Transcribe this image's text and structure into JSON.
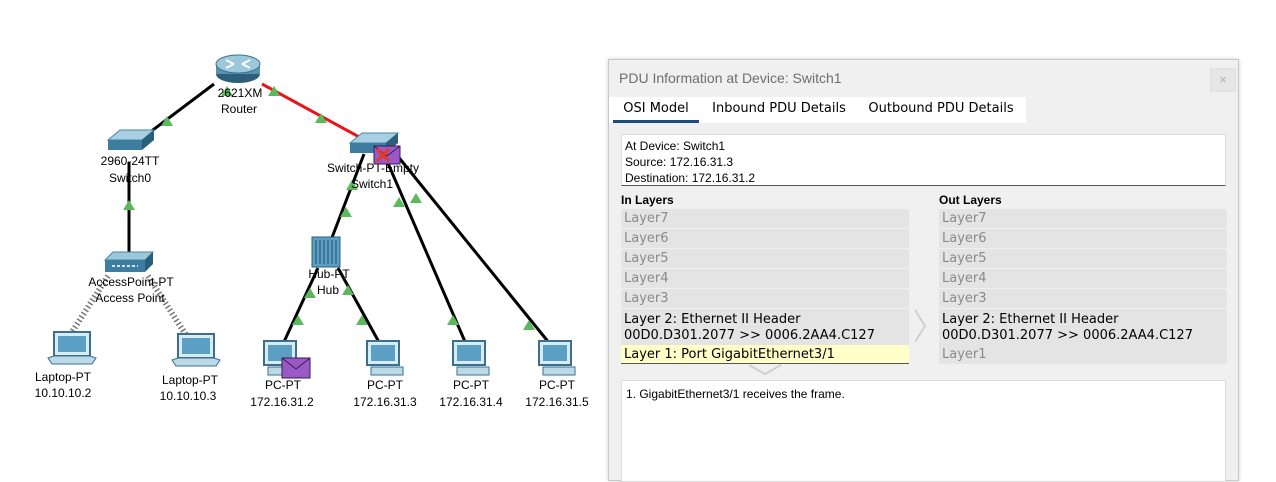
{
  "topology": {
    "devices": [
      {
        "id": "router",
        "model": "2621XM",
        "name": "Router"
      },
      {
        "id": "switch0",
        "model": "2960-24TT",
        "name": "Switch0"
      },
      {
        "id": "switch1",
        "model": "Switch-PT-Empty",
        "name": "Switch1"
      },
      {
        "id": "ap",
        "model": "AccessPoint-PT",
        "name": "Access Point"
      },
      {
        "id": "hub",
        "model": "Hub-PT",
        "name": "Hub"
      },
      {
        "id": "laptop1",
        "model": "Laptop-PT",
        "ip": "10.10.10.2"
      },
      {
        "id": "laptop2",
        "model": "Laptop-PT",
        "ip": "10.10.10.3"
      },
      {
        "id": "pc1",
        "model": "PC-PT",
        "ip": "172.16.31.2"
      },
      {
        "id": "pc2",
        "model": "PC-PT",
        "ip": "172.16.31.3"
      },
      {
        "id": "pc3",
        "model": "PC-PT",
        "ip": "172.16.31.4"
      },
      {
        "id": "pc4",
        "model": "PC-PT",
        "ip": "172.16.31.5"
      }
    ],
    "link_up_color": "#5cb85c",
    "active_link_color": "#e8161b"
  },
  "pdu": {
    "title": "PDU Information at Device: Switch1",
    "close": "×",
    "tabs": [
      "OSI Model",
      "Inbound PDU Details",
      "Outbound PDU Details"
    ],
    "summary": {
      "device": "At Device: Switch1",
      "source": "Source: 172.16.31.3",
      "destination": "Destination: 172.16.31.2"
    },
    "in_layers_title": "In Layers",
    "out_layers_title": "Out Layers",
    "in_layers": [
      "Layer7",
      "Layer6",
      "Layer5",
      "Layer4",
      "Layer3"
    ],
    "in_layer2_line1": "Layer 2: Ethernet II Header",
    "in_layer2_line2": "00D0.D301.2077 >> 0006.2AA4.C127",
    "in_layer1": "Layer 1: Port GigabitEthernet3/1",
    "out_layers": [
      "Layer7",
      "Layer6",
      "Layer5",
      "Layer4",
      "Layer3"
    ],
    "out_layer2_line1": "Layer 2: Ethernet II Header",
    "out_layer2_line2": "00D0.D301.2077 >> 0006.2AA4.C127",
    "out_layer1": "Layer1",
    "description": "1. GigabitEthernet3/1 receives the frame."
  }
}
